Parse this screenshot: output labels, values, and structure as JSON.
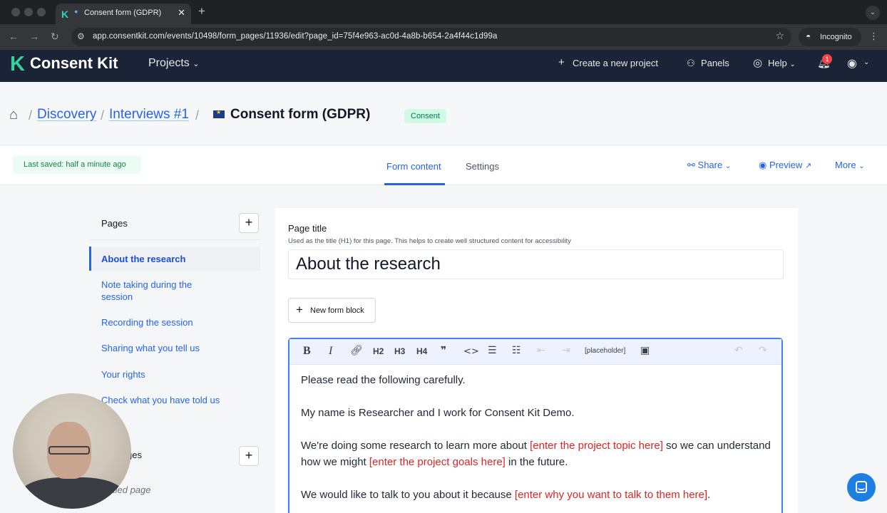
{
  "browser": {
    "tab_title": "Consent form (GDPR)",
    "url": "app.consentkit.com/events/10498/form_pages/11936/edit?page_id=75f4e963-ac0d-4a8b-b654-2a4f44c1d99a",
    "incognito_label": "Incognito"
  },
  "appnav": {
    "logo_text": "Consent Kit",
    "projects_label": "Projects",
    "create_label": "Create a new project",
    "panels_label": "Panels",
    "help_label": "Help",
    "notification_count": "1"
  },
  "breadcrumb": {
    "items": [
      "Discovery",
      "Interviews #1"
    ],
    "current": "Consent form (GDPR)",
    "badge": "Consent"
  },
  "subbar": {
    "saved_status": "Last saved: half a minute ago",
    "tabs": [
      "Form content",
      "Settings"
    ],
    "share_label": "Share",
    "preview_label": "Preview",
    "more_label": "More"
  },
  "sidebar": {
    "pages_title": "Pages",
    "items": [
      "About the research",
      "Note taking during the session",
      "Recording the session",
      "Sharing what you tell us",
      "Your rights",
      "Check what you have told us"
    ],
    "second_section_partial": "ges",
    "untitled_partial": "tled page"
  },
  "editor": {
    "field_label": "Page title",
    "field_help": "Used as the title (H1) for this page. This helps to create well structured content for accessibility",
    "title_value": "About the research",
    "new_block_label": "New form block",
    "toolbar": {
      "h2": "H2",
      "h3": "H3",
      "h4": "H4",
      "placeholder": "[placeholder]"
    },
    "body": {
      "p1": "Please read the following carefully.",
      "p2": "My name is Researcher and I work for Consent Kit Demo.",
      "p3_a": "We're doing some research to learn more about ",
      "p3_ph1": "[enter the project topic here]",
      "p3_b": " so we can understand how we might ",
      "p3_ph2": "[enter the project goals here]",
      "p3_c": " in the future.",
      "p4_a": "We would like to talk to you about it because ",
      "p4_ph": "[enter why you want to talk to them here]",
      "p4_b": "."
    }
  },
  "colors": {
    "brand_green": "#34d399",
    "nav_bg": "#1b2436",
    "link_blue": "#2563eb",
    "placeholder_red": "#dc2626"
  }
}
